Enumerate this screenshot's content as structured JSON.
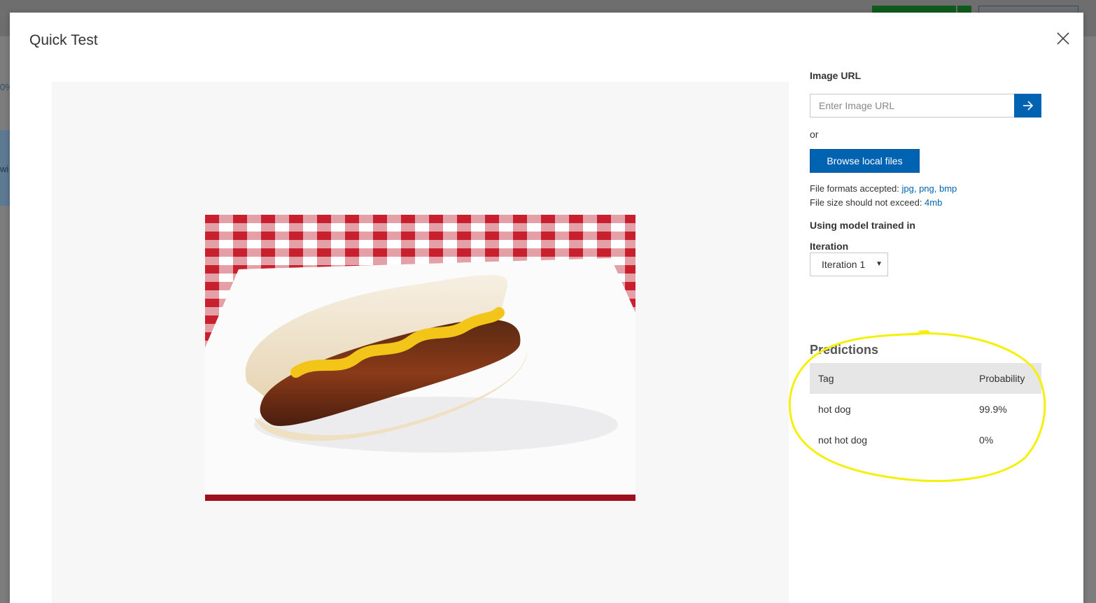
{
  "background": {
    "left_fragments": [
      "0%",
      "wi"
    ]
  },
  "modal": {
    "title": "Quick Test"
  },
  "image_url": {
    "label": "Image URL",
    "placeholder": "Enter Image URL"
  },
  "or_text": "or",
  "browse_button_label": "Browse local files",
  "file_formats": {
    "prefix": "File formats accepted: ",
    "formats": "jpg, png, bmp"
  },
  "file_size": {
    "prefix": "File size should not exceed: ",
    "limit": "4mb"
  },
  "model": {
    "label": "Using model trained in",
    "iteration_label": "Iteration",
    "iteration_value": "Iteration 1"
  },
  "predictions": {
    "title": "Predictions",
    "columns": [
      "Tag",
      "Probability"
    ],
    "rows": [
      {
        "tag": "hot dog",
        "probability": "99.9%"
      },
      {
        "tag": "not hot dog",
        "probability": "0%"
      }
    ]
  },
  "colors": {
    "accent": "#0063b1",
    "annotation": "#f5f00a"
  }
}
